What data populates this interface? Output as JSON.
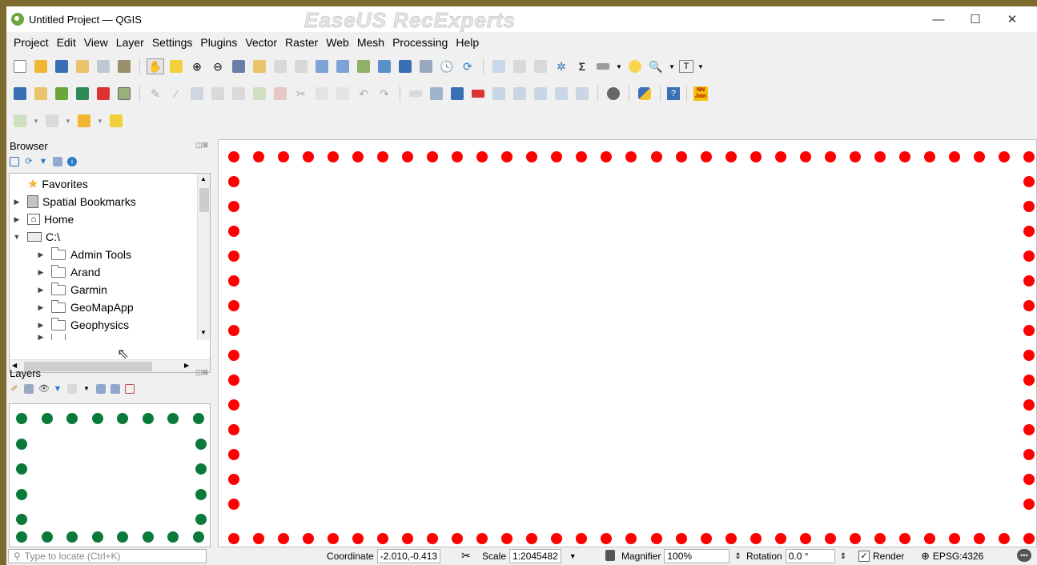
{
  "window": {
    "title": "Untitled Project — QGIS",
    "minimize_glyph": "—",
    "maximize_glyph": "☐",
    "close_glyph": "✕"
  },
  "watermark": "EaseUS RecExperts",
  "menu": [
    "Project",
    "Edit",
    "View",
    "Layer",
    "Settings",
    "Plugins",
    "Vector",
    "Raster",
    "Web",
    "Mesh",
    "Processing",
    "Help"
  ],
  "toolbar": {
    "sum_glyph": "Σ",
    "nn_join_label": "NN Join",
    "help_glyph": "?",
    "text_glyph": "T"
  },
  "browser": {
    "title": "Browser",
    "items": [
      {
        "label": "Favorites",
        "icon": "star-icon"
      },
      {
        "label": "Spatial Bookmarks",
        "icon": "bookmark-icon"
      },
      {
        "label": "Home",
        "icon": "home-icon"
      },
      {
        "label": "C:\\",
        "icon": "drive-icon"
      },
      {
        "label": "Admin Tools",
        "icon": "folder-icon"
      },
      {
        "label": "Arand",
        "icon": "folder-icon"
      },
      {
        "label": "Garmin",
        "icon": "folder-icon"
      },
      {
        "label": "GeoMapApp",
        "icon": "folder-icon"
      },
      {
        "label": "Geophysics",
        "icon": "folder-icon"
      }
    ]
  },
  "layers": {
    "title": "Layers"
  },
  "statusbar": {
    "locate_placeholder": "Type to locate (Ctrl+K)",
    "coordinate_label": "Coordinate",
    "coordinate_value": "-2.010,-0.413",
    "scale_label": "Scale",
    "scale_value": "1:2045482",
    "magnifier_label": "Magnifier",
    "magnifier_value": "100%",
    "rotation_label": "Rotation",
    "rotation_value": "0.0 °",
    "render_label": "Render",
    "crs_label": "EPSG:4326"
  },
  "colors": {
    "map_highlight": "#ff0000",
    "layers_highlight": "#0a7a3a",
    "qgis_green": "#6aa63a"
  }
}
